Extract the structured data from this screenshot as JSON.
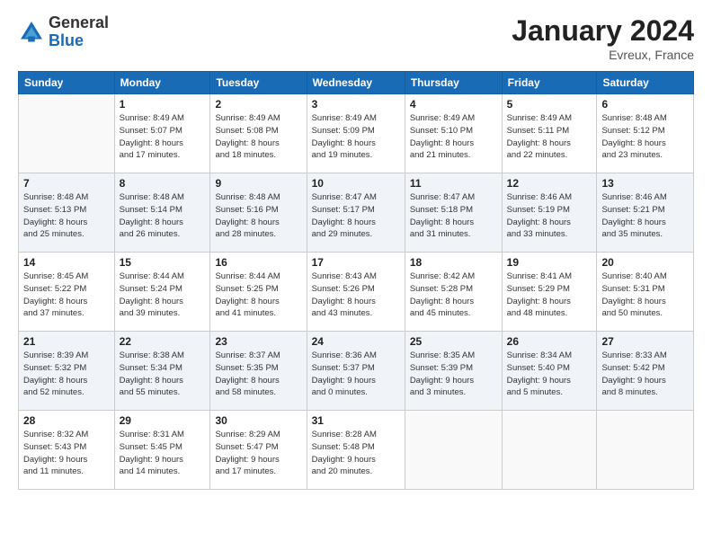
{
  "logo": {
    "general": "General",
    "blue": "Blue"
  },
  "header": {
    "title": "January 2024",
    "location": "Evreux, France"
  },
  "weekdays": [
    "Sunday",
    "Monday",
    "Tuesday",
    "Wednesday",
    "Thursday",
    "Friday",
    "Saturday"
  ],
  "weeks": [
    {
      "shade": "white",
      "days": [
        {
          "num": "",
          "info": ""
        },
        {
          "num": "1",
          "info": "Sunrise: 8:49 AM\nSunset: 5:07 PM\nDaylight: 8 hours\nand 17 minutes."
        },
        {
          "num": "2",
          "info": "Sunrise: 8:49 AM\nSunset: 5:08 PM\nDaylight: 8 hours\nand 18 minutes."
        },
        {
          "num": "3",
          "info": "Sunrise: 8:49 AM\nSunset: 5:09 PM\nDaylight: 8 hours\nand 19 minutes."
        },
        {
          "num": "4",
          "info": "Sunrise: 8:49 AM\nSunset: 5:10 PM\nDaylight: 8 hours\nand 21 minutes."
        },
        {
          "num": "5",
          "info": "Sunrise: 8:49 AM\nSunset: 5:11 PM\nDaylight: 8 hours\nand 22 minutes."
        },
        {
          "num": "6",
          "info": "Sunrise: 8:48 AM\nSunset: 5:12 PM\nDaylight: 8 hours\nand 23 minutes."
        }
      ]
    },
    {
      "shade": "shaded",
      "days": [
        {
          "num": "7",
          "info": "Sunrise: 8:48 AM\nSunset: 5:13 PM\nDaylight: 8 hours\nand 25 minutes."
        },
        {
          "num": "8",
          "info": "Sunrise: 8:48 AM\nSunset: 5:14 PM\nDaylight: 8 hours\nand 26 minutes."
        },
        {
          "num": "9",
          "info": "Sunrise: 8:48 AM\nSunset: 5:16 PM\nDaylight: 8 hours\nand 28 minutes."
        },
        {
          "num": "10",
          "info": "Sunrise: 8:47 AM\nSunset: 5:17 PM\nDaylight: 8 hours\nand 29 minutes."
        },
        {
          "num": "11",
          "info": "Sunrise: 8:47 AM\nSunset: 5:18 PM\nDaylight: 8 hours\nand 31 minutes."
        },
        {
          "num": "12",
          "info": "Sunrise: 8:46 AM\nSunset: 5:19 PM\nDaylight: 8 hours\nand 33 minutes."
        },
        {
          "num": "13",
          "info": "Sunrise: 8:46 AM\nSunset: 5:21 PM\nDaylight: 8 hours\nand 35 minutes."
        }
      ]
    },
    {
      "shade": "white",
      "days": [
        {
          "num": "14",
          "info": "Sunrise: 8:45 AM\nSunset: 5:22 PM\nDaylight: 8 hours\nand 37 minutes."
        },
        {
          "num": "15",
          "info": "Sunrise: 8:44 AM\nSunset: 5:24 PM\nDaylight: 8 hours\nand 39 minutes."
        },
        {
          "num": "16",
          "info": "Sunrise: 8:44 AM\nSunset: 5:25 PM\nDaylight: 8 hours\nand 41 minutes."
        },
        {
          "num": "17",
          "info": "Sunrise: 8:43 AM\nSunset: 5:26 PM\nDaylight: 8 hours\nand 43 minutes."
        },
        {
          "num": "18",
          "info": "Sunrise: 8:42 AM\nSunset: 5:28 PM\nDaylight: 8 hours\nand 45 minutes."
        },
        {
          "num": "19",
          "info": "Sunrise: 8:41 AM\nSunset: 5:29 PM\nDaylight: 8 hours\nand 48 minutes."
        },
        {
          "num": "20",
          "info": "Sunrise: 8:40 AM\nSunset: 5:31 PM\nDaylight: 8 hours\nand 50 minutes."
        }
      ]
    },
    {
      "shade": "shaded",
      "days": [
        {
          "num": "21",
          "info": "Sunrise: 8:39 AM\nSunset: 5:32 PM\nDaylight: 8 hours\nand 52 minutes."
        },
        {
          "num": "22",
          "info": "Sunrise: 8:38 AM\nSunset: 5:34 PM\nDaylight: 8 hours\nand 55 minutes."
        },
        {
          "num": "23",
          "info": "Sunrise: 8:37 AM\nSunset: 5:35 PM\nDaylight: 8 hours\nand 58 minutes."
        },
        {
          "num": "24",
          "info": "Sunrise: 8:36 AM\nSunset: 5:37 PM\nDaylight: 9 hours\nand 0 minutes."
        },
        {
          "num": "25",
          "info": "Sunrise: 8:35 AM\nSunset: 5:39 PM\nDaylight: 9 hours\nand 3 minutes."
        },
        {
          "num": "26",
          "info": "Sunrise: 8:34 AM\nSunset: 5:40 PM\nDaylight: 9 hours\nand 5 minutes."
        },
        {
          "num": "27",
          "info": "Sunrise: 8:33 AM\nSunset: 5:42 PM\nDaylight: 9 hours\nand 8 minutes."
        }
      ]
    },
    {
      "shade": "white",
      "days": [
        {
          "num": "28",
          "info": "Sunrise: 8:32 AM\nSunset: 5:43 PM\nDaylight: 9 hours\nand 11 minutes."
        },
        {
          "num": "29",
          "info": "Sunrise: 8:31 AM\nSunset: 5:45 PM\nDaylight: 9 hours\nand 14 minutes."
        },
        {
          "num": "30",
          "info": "Sunrise: 8:29 AM\nSunset: 5:47 PM\nDaylight: 9 hours\nand 17 minutes."
        },
        {
          "num": "31",
          "info": "Sunrise: 8:28 AM\nSunset: 5:48 PM\nDaylight: 9 hours\nand 20 minutes."
        },
        {
          "num": "",
          "info": ""
        },
        {
          "num": "",
          "info": ""
        },
        {
          "num": "",
          "info": ""
        }
      ]
    }
  ]
}
